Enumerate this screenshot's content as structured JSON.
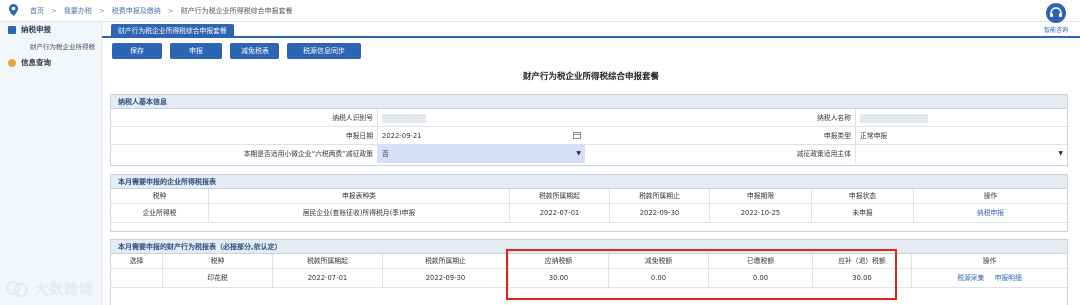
{
  "breadcrumb": [
    "首页",
    "我要办税",
    "税费申报及缴纳",
    "财产行为税企业所得税综合申报套餐"
  ],
  "sidebar": {
    "items": [
      {
        "label": "纳税申报",
        "icon": "tax-report-icon"
      },
      {
        "label": "信息查询",
        "icon": "info-query-icon"
      }
    ],
    "sub_item": "财产行为税企业所得税"
  },
  "tab": "财产行为税企业所得税综合申报套餐",
  "assistant": {
    "label": "智能咨询",
    "icon": "headset-icon"
  },
  "toolbar": {
    "save": "保存",
    "submit": "申报",
    "reduce": "减免税表",
    "sync": "税源信息同步"
  },
  "main_title": "财产行为税企业所得税综合申报套餐",
  "basic": {
    "header": "纳税人基本信息",
    "taxpayer_id_label": "纳税人识别号",
    "taxpayer_name_label": "纳税人名称",
    "report_date_label": "申报日期",
    "report_date": "2022-09-21",
    "report_type_label": "申报类型",
    "report_type": "正常申报",
    "policy_label": "本期是否适用小微企业“六税两费”减征政策",
    "policy_value": "否",
    "policy_subject_label": "减征政策适用主体",
    "policy_subject_value": ""
  },
  "income_tax": {
    "header": "本月需要申报的企业所得税报表",
    "columns": [
      "税种",
      "申报表种类",
      "税款所属期起",
      "税款所属期止",
      "申报期限",
      "申报状态",
      "操作"
    ],
    "rows": [
      [
        "企业所得税",
        "居民企业(查账征收)所得税月(季)申报",
        "2022-07-01",
        "2022-09-30",
        "2022-10-25",
        "未申报",
        "纳税申报"
      ]
    ]
  },
  "property_tax": {
    "header": "本月需要申报的财产行为税报表（必报部分,依认定）",
    "columns": [
      "选择",
      "税种",
      "税款所属期起",
      "税款所属期止",
      "应纳税额",
      "减免税额",
      "已缴税额",
      "应补（退）税额",
      "操作"
    ],
    "rows": [
      {
        "select": "",
        "tax": "印花税",
        "start": "2022-07-01",
        "end": "2022-09-30",
        "payable": "30.00",
        "reduced": "0.00",
        "paid": "0.00",
        "due": "30.00",
        "op1": "税源采集",
        "op2": "申报明细"
      }
    ]
  },
  "watermark": "大数跨境",
  "colors": {
    "primary": "#2d64b3",
    "highlight_border": "#e2231a",
    "header_bg": "#e4ebf3"
  }
}
